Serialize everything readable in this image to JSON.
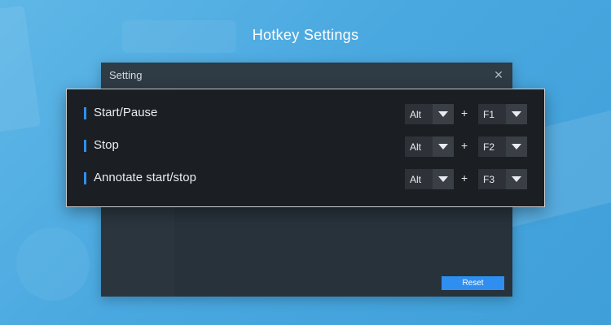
{
  "page": {
    "title": "Hotkey Settings"
  },
  "window": {
    "title": "Setting",
    "close_icon": "close-icon",
    "reset_label": "Reset"
  },
  "hotkeys": [
    {
      "label": "Start/Pause",
      "modifier": "Alt",
      "plus": "+",
      "key": "F1"
    },
    {
      "label": "Stop",
      "modifier": "Alt",
      "plus": "+",
      "key": "F2"
    },
    {
      "label": "Annotate start/stop",
      "modifier": "Alt",
      "plus": "+",
      "key": "F3"
    }
  ],
  "colors": {
    "accent": "#2f8ff0",
    "background": "#4aa8e0",
    "panel": "#1b1e22",
    "window": "#2d3942"
  }
}
